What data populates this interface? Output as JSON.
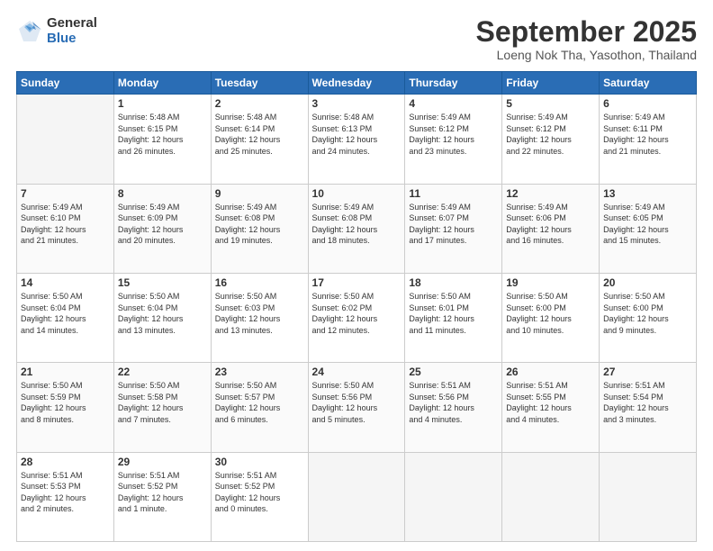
{
  "logo": {
    "general": "General",
    "blue": "Blue"
  },
  "header": {
    "title": "September 2025",
    "location": "Loeng Nok Tha, Yasothon, Thailand"
  },
  "weekdays": [
    "Sunday",
    "Monday",
    "Tuesday",
    "Wednesday",
    "Thursday",
    "Friday",
    "Saturday"
  ],
  "weeks": [
    [
      {
        "day": "",
        "info": ""
      },
      {
        "day": "1",
        "info": "Sunrise: 5:48 AM\nSunset: 6:15 PM\nDaylight: 12 hours\nand 26 minutes."
      },
      {
        "day": "2",
        "info": "Sunrise: 5:48 AM\nSunset: 6:14 PM\nDaylight: 12 hours\nand 25 minutes."
      },
      {
        "day": "3",
        "info": "Sunrise: 5:48 AM\nSunset: 6:13 PM\nDaylight: 12 hours\nand 24 minutes."
      },
      {
        "day": "4",
        "info": "Sunrise: 5:49 AM\nSunset: 6:12 PM\nDaylight: 12 hours\nand 23 minutes."
      },
      {
        "day": "5",
        "info": "Sunrise: 5:49 AM\nSunset: 6:12 PM\nDaylight: 12 hours\nand 22 minutes."
      },
      {
        "day": "6",
        "info": "Sunrise: 5:49 AM\nSunset: 6:11 PM\nDaylight: 12 hours\nand 21 minutes."
      }
    ],
    [
      {
        "day": "7",
        "info": "Sunrise: 5:49 AM\nSunset: 6:10 PM\nDaylight: 12 hours\nand 21 minutes."
      },
      {
        "day": "8",
        "info": "Sunrise: 5:49 AM\nSunset: 6:09 PM\nDaylight: 12 hours\nand 20 minutes."
      },
      {
        "day": "9",
        "info": "Sunrise: 5:49 AM\nSunset: 6:08 PM\nDaylight: 12 hours\nand 19 minutes."
      },
      {
        "day": "10",
        "info": "Sunrise: 5:49 AM\nSunset: 6:08 PM\nDaylight: 12 hours\nand 18 minutes."
      },
      {
        "day": "11",
        "info": "Sunrise: 5:49 AM\nSunset: 6:07 PM\nDaylight: 12 hours\nand 17 minutes."
      },
      {
        "day": "12",
        "info": "Sunrise: 5:49 AM\nSunset: 6:06 PM\nDaylight: 12 hours\nand 16 minutes."
      },
      {
        "day": "13",
        "info": "Sunrise: 5:49 AM\nSunset: 6:05 PM\nDaylight: 12 hours\nand 15 minutes."
      }
    ],
    [
      {
        "day": "14",
        "info": "Sunrise: 5:50 AM\nSunset: 6:04 PM\nDaylight: 12 hours\nand 14 minutes."
      },
      {
        "day": "15",
        "info": "Sunrise: 5:50 AM\nSunset: 6:04 PM\nDaylight: 12 hours\nand 13 minutes."
      },
      {
        "day": "16",
        "info": "Sunrise: 5:50 AM\nSunset: 6:03 PM\nDaylight: 12 hours\nand 13 minutes."
      },
      {
        "day": "17",
        "info": "Sunrise: 5:50 AM\nSunset: 6:02 PM\nDaylight: 12 hours\nand 12 minutes."
      },
      {
        "day": "18",
        "info": "Sunrise: 5:50 AM\nSunset: 6:01 PM\nDaylight: 12 hours\nand 11 minutes."
      },
      {
        "day": "19",
        "info": "Sunrise: 5:50 AM\nSunset: 6:00 PM\nDaylight: 12 hours\nand 10 minutes."
      },
      {
        "day": "20",
        "info": "Sunrise: 5:50 AM\nSunset: 6:00 PM\nDaylight: 12 hours\nand 9 minutes."
      }
    ],
    [
      {
        "day": "21",
        "info": "Sunrise: 5:50 AM\nSunset: 5:59 PM\nDaylight: 12 hours\nand 8 minutes."
      },
      {
        "day": "22",
        "info": "Sunrise: 5:50 AM\nSunset: 5:58 PM\nDaylight: 12 hours\nand 7 minutes."
      },
      {
        "day": "23",
        "info": "Sunrise: 5:50 AM\nSunset: 5:57 PM\nDaylight: 12 hours\nand 6 minutes."
      },
      {
        "day": "24",
        "info": "Sunrise: 5:50 AM\nSunset: 5:56 PM\nDaylight: 12 hours\nand 5 minutes."
      },
      {
        "day": "25",
        "info": "Sunrise: 5:51 AM\nSunset: 5:56 PM\nDaylight: 12 hours\nand 4 minutes."
      },
      {
        "day": "26",
        "info": "Sunrise: 5:51 AM\nSunset: 5:55 PM\nDaylight: 12 hours\nand 4 minutes."
      },
      {
        "day": "27",
        "info": "Sunrise: 5:51 AM\nSunset: 5:54 PM\nDaylight: 12 hours\nand 3 minutes."
      }
    ],
    [
      {
        "day": "28",
        "info": "Sunrise: 5:51 AM\nSunset: 5:53 PM\nDaylight: 12 hours\nand 2 minutes."
      },
      {
        "day": "29",
        "info": "Sunrise: 5:51 AM\nSunset: 5:52 PM\nDaylight: 12 hours\nand 1 minute."
      },
      {
        "day": "30",
        "info": "Sunrise: 5:51 AM\nSunset: 5:52 PM\nDaylight: 12 hours\nand 0 minutes."
      },
      {
        "day": "",
        "info": ""
      },
      {
        "day": "",
        "info": ""
      },
      {
        "day": "",
        "info": ""
      },
      {
        "day": "",
        "info": ""
      }
    ]
  ]
}
